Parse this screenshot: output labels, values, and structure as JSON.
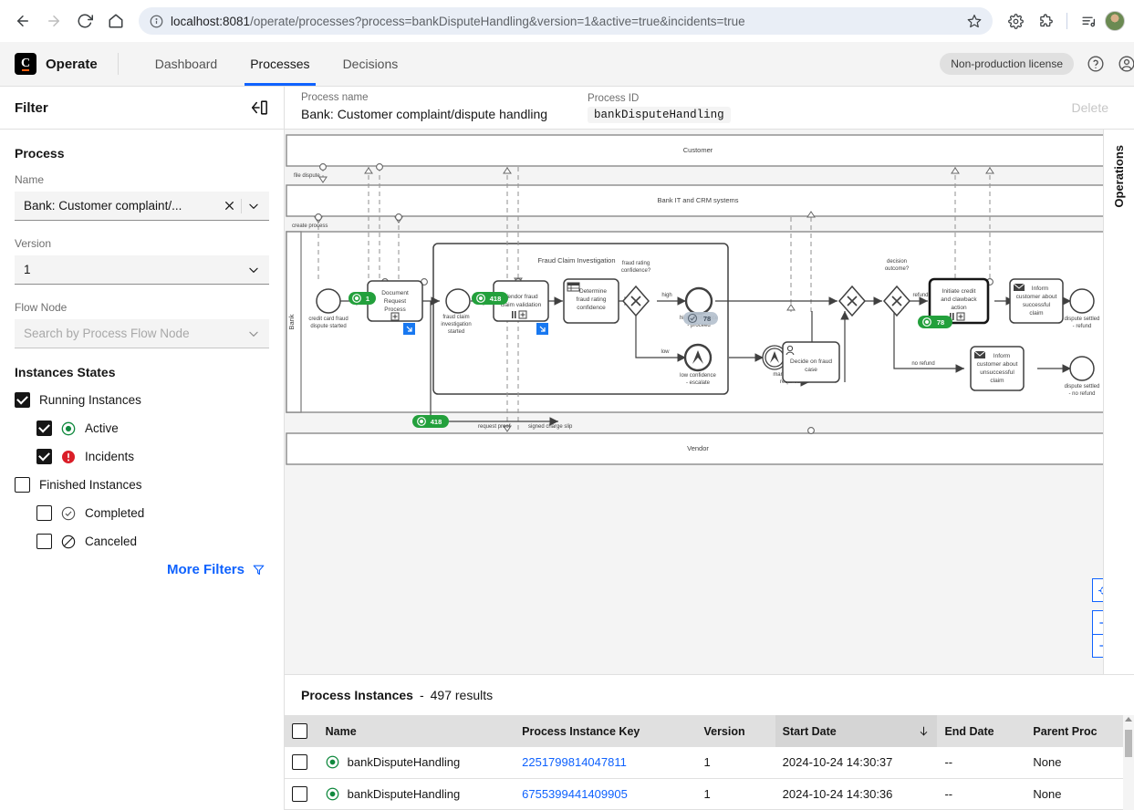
{
  "browser": {
    "url_host": "localhost:8081",
    "url_path": "/operate/processes?process=bankDisputeHandling&version=1&active=true&incidents=true",
    "back_icon": "back-arrow-icon",
    "forward_icon": "forward-arrow-icon",
    "reload_icon": "reload-icon",
    "home_icon": "home-icon",
    "info_icon": "site-info-icon",
    "star_icon": "bookmark-star-icon",
    "settings_icon": "gear-icon",
    "extensions_icon": "extensions-icon",
    "reading_list_icon": "reading-list-icon",
    "profile_icon": "profile-avatar"
  },
  "header": {
    "brand": "Operate",
    "logo_letter": "C",
    "tabs": [
      {
        "label": "Dashboard",
        "active": false
      },
      {
        "label": "Processes",
        "active": true
      },
      {
        "label": "Decisions",
        "active": false
      }
    ],
    "license_badge": "Non-production license",
    "help_icon": "help-circle-icon",
    "user_icon": "user-circle-icon"
  },
  "sidebar": {
    "title": "Filter",
    "collapse_icon": "collapse-panel-icon",
    "process_section": "Process",
    "name_label": "Name",
    "name_value": "Bank: Customer complaint/...",
    "version_label": "Version",
    "version_value": "1",
    "flow_node_label": "Flow Node",
    "flow_node_placeholder": "Search by Process Flow Node",
    "states_title": "Instances States",
    "states": [
      {
        "label": "Running Instances",
        "checked": true,
        "indent": false,
        "icon": "none"
      },
      {
        "label": "Active",
        "checked": true,
        "indent": true,
        "icon": "active-icon"
      },
      {
        "label": "Incidents",
        "checked": true,
        "indent": true,
        "icon": "incident-icon"
      },
      {
        "label": "Finished Instances",
        "checked": false,
        "indent": false,
        "icon": "none"
      },
      {
        "label": "Completed",
        "checked": false,
        "indent": true,
        "icon": "completed-icon"
      },
      {
        "label": "Canceled",
        "checked": false,
        "indent": true,
        "icon": "canceled-icon"
      }
    ],
    "more_filters": "More Filters",
    "more_filters_icon": "filter-funnel-icon"
  },
  "process_header": {
    "name_label": "Process name",
    "name_value": "Bank: Customer complaint/dispute handling",
    "id_label": "Process ID",
    "id_value": "bankDisputeHandling",
    "delete_label": "Delete"
  },
  "operations_panel": {
    "label": "Operations",
    "expand_icon": "expand-panel-icon"
  },
  "diagram": {
    "pools": [
      {
        "name": "Customer"
      },
      {
        "name": "Bank IT and CRM systems"
      },
      {
        "name": "Vendor"
      },
      {
        "name": "Bank"
      }
    ],
    "subprocess_label": "Fraud Claim Investigation",
    "tasks": [
      {
        "id": "documentRequestProcess",
        "label": "Document Request Process",
        "markers": "call-activity"
      },
      {
        "id": "vendorFraudClaimValidation",
        "label": "Vendor fraud claim validation",
        "markers": "call-activity-multi"
      },
      {
        "id": "determineFraudRating",
        "label": "Determine fraud rating confidence",
        "markers": "business-rule-task"
      },
      {
        "id": "decideOnFraudCase",
        "label": "Decide on fraud case",
        "markers": "user-task"
      },
      {
        "id": "initiateCredit",
        "label": "Initiate credit and clawback action",
        "markers": "call-activity-multi",
        "selected": true
      },
      {
        "id": "informSuccessful",
        "label": "Inform customer about successful claim",
        "markers": "send-task"
      },
      {
        "id": "informUnsuccessful",
        "label": "Inform customer about unsuccessful claim",
        "markers": "send-task"
      }
    ],
    "events": [
      {
        "label": "credit card fraud dispute started"
      },
      {
        "label": "fraud claim investigation started"
      },
      {
        "label": "high confidence - proceed"
      },
      {
        "label": "low confidence - escalate"
      },
      {
        "label": "manual decision required"
      },
      {
        "label": "dispute settled - refund"
      },
      {
        "label": "dispute settled - no refund"
      }
    ],
    "gateways": [
      {
        "label": "fraud rating confidence?"
      },
      {
        "label": "decision outcome?"
      }
    ],
    "flow_labels": [
      "file dispute",
      "create process",
      "high",
      "low",
      "refund",
      "no refund",
      "request proof",
      "signed charge slip"
    ],
    "badges": [
      {
        "value": "1",
        "type": "active",
        "target": "documentRequestProcess"
      },
      {
        "value": "418",
        "type": "active",
        "target": "vendorFraudClaimValidation"
      },
      {
        "value": "418",
        "type": "active",
        "target": "sequence-flow"
      },
      {
        "value": "78",
        "type": "completed",
        "target": "high-confidence-event"
      },
      {
        "value": "78",
        "type": "active",
        "target": "initiateCredit"
      }
    ],
    "zoom_controls": {
      "reset_icon": "reset-zoom-icon",
      "zoom_in_label": "+",
      "zoom_out_label": "−"
    }
  },
  "instances": {
    "title": "Process Instances",
    "separator": "-",
    "results_text": "497 results",
    "columns": [
      "Name",
      "Process Instance Key",
      "Version",
      "Start Date",
      "End Date",
      "Parent Proc"
    ],
    "sorted_column": "Start Date",
    "sort_direction": "desc",
    "rows": [
      {
        "name": "bankDisputeHandling",
        "key": "2251799814047811",
        "version": "1",
        "start_date": "2024-10-24 14:30:37",
        "end_date": "--",
        "parent": "None",
        "state": "active"
      },
      {
        "name": "bankDisputeHandling",
        "key": "6755399441409905",
        "version": "1",
        "start_date": "2024-10-24 14:30:36",
        "end_date": "--",
        "parent": "None",
        "state": "active"
      }
    ]
  },
  "colors": {
    "accent_blue": "#0f62fe",
    "active_green": "#10893e",
    "incident_red": "#da1e28",
    "badge_green": "#23a03c"
  }
}
